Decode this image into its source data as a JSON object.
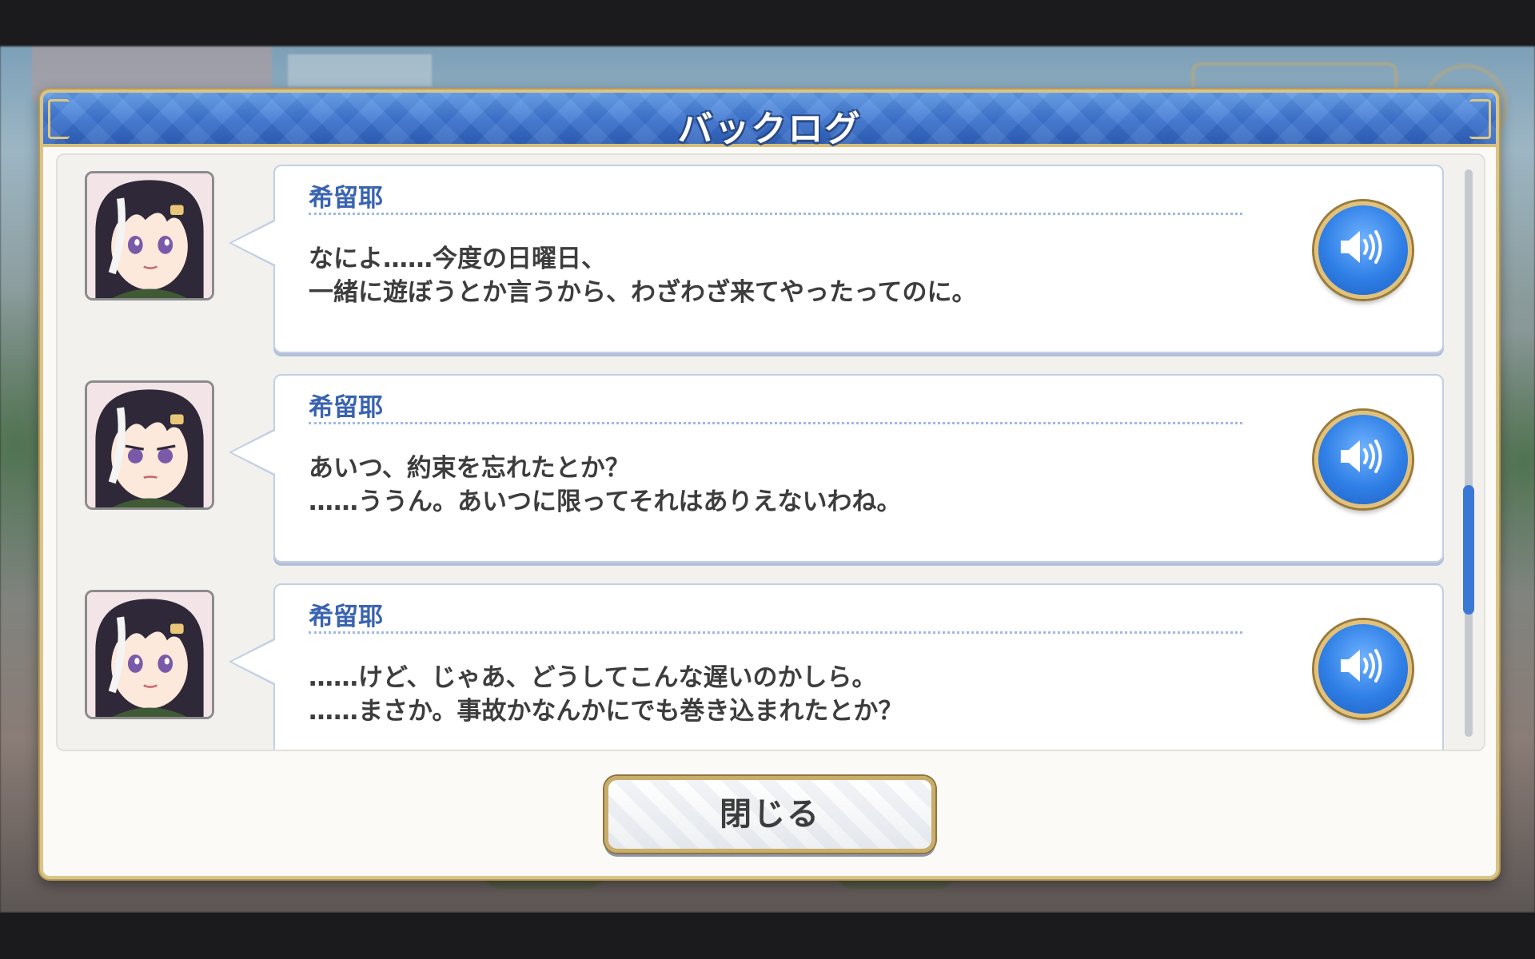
{
  "dialog": {
    "title": "バックログ",
    "close_label": "閉じる"
  },
  "entries": [
    {
      "speaker": "希留耶",
      "lines": [
        "なによ……今度の日曜日、",
        "一緒に遊ぼうとか言うから、わざわざ来てやったってのに。"
      ]
    },
    {
      "speaker": "希留耶",
      "lines": [
        "あいつ、約束を忘れたとか？",
        "……ううん。あいつに限ってそれはありえないわね。"
      ]
    },
    {
      "speaker": "希留耶",
      "lines": [
        "……けど、じゃあ、どうしてこんな遅いのかしら。",
        "……まさか。事故かなんかにでも巻き込まれたとか？"
      ]
    }
  ],
  "colors": {
    "header_blue": "#3c74d1",
    "speaker_name": "#3a63b0",
    "gold_border": "#d8c48a",
    "voice_button": "#2f7fe6"
  },
  "icons": {
    "voice": "speaker-volume-icon"
  },
  "scroll": {
    "position_fraction": 0.72
  }
}
